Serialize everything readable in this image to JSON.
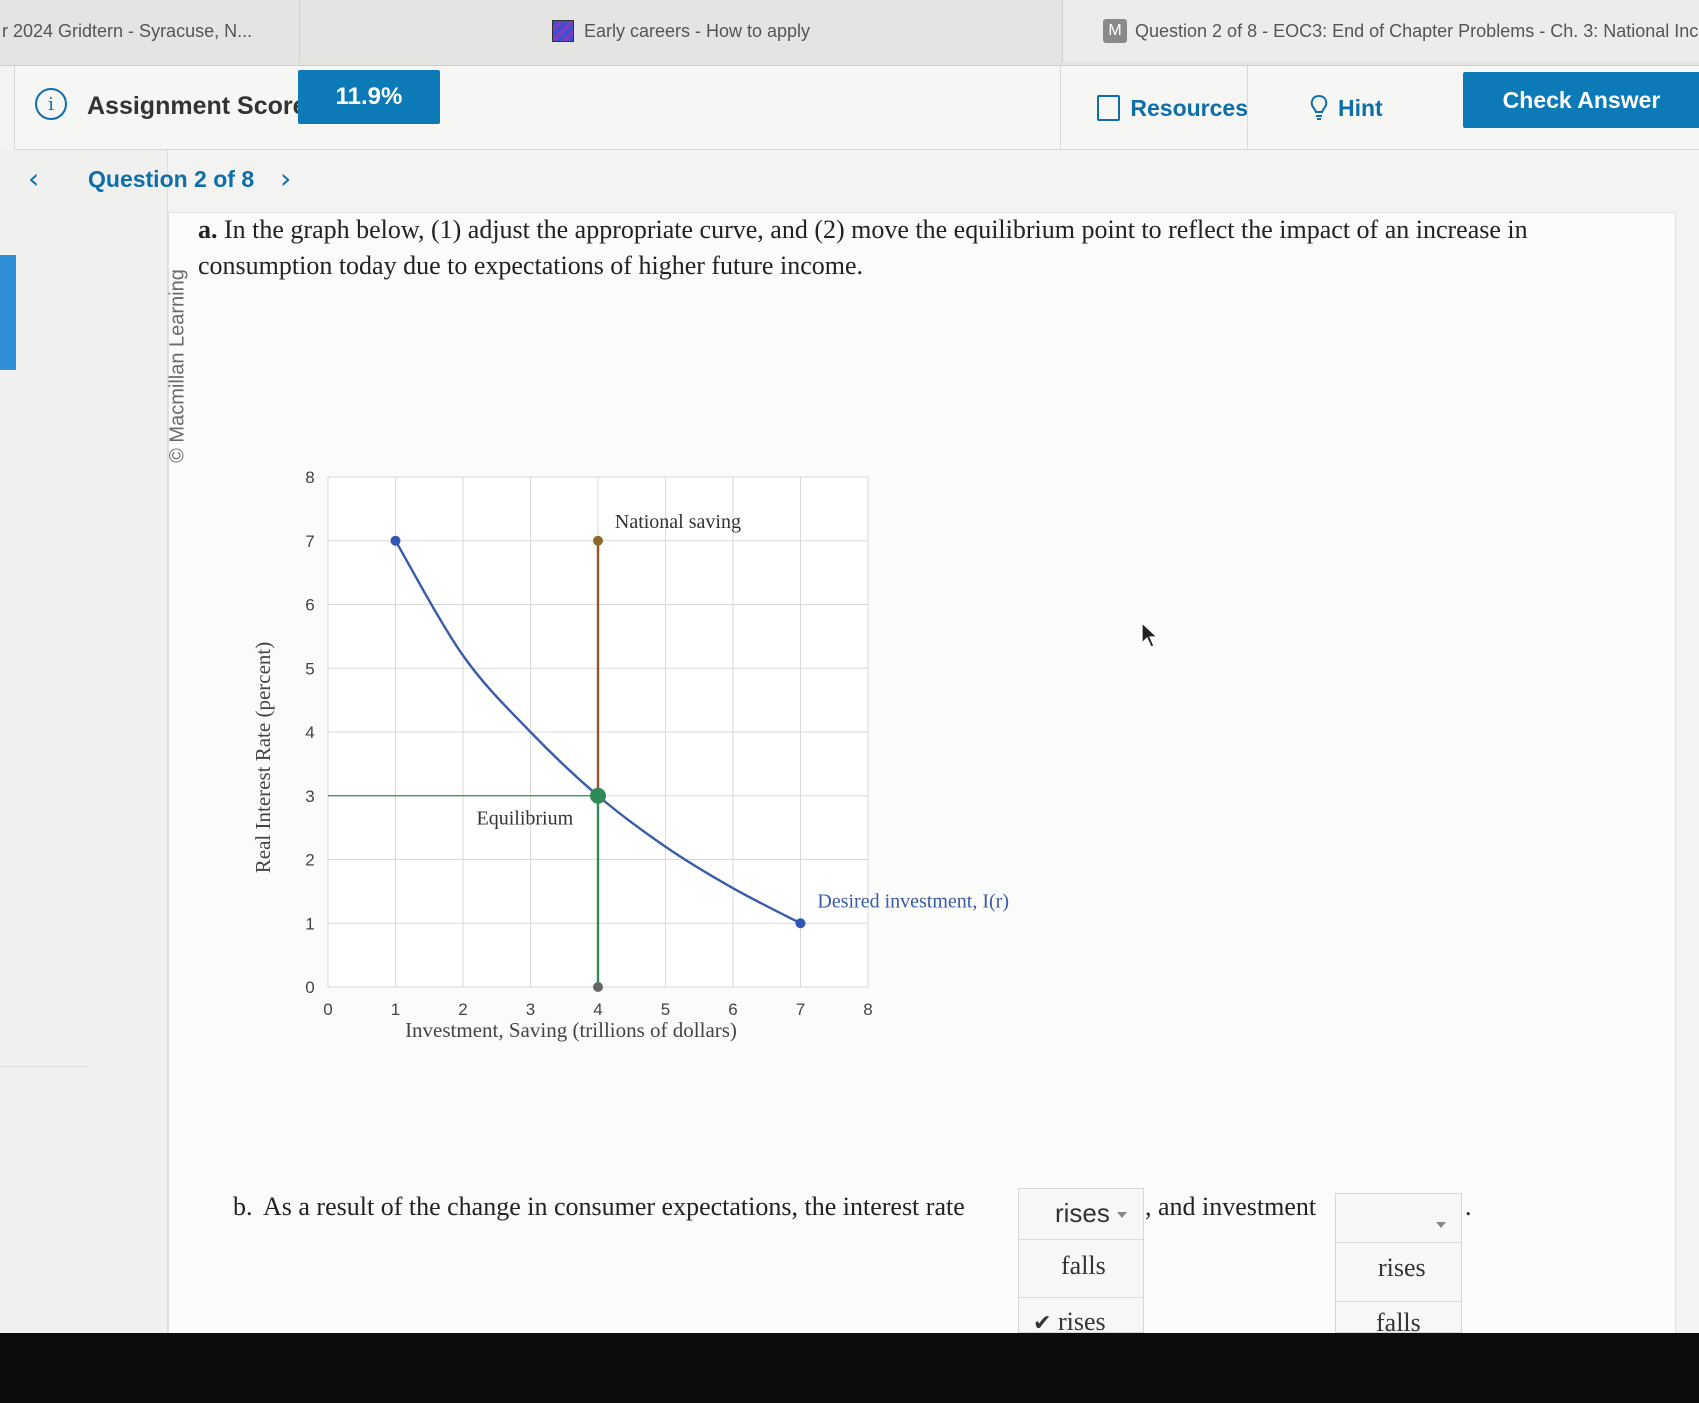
{
  "tabs": [
    {
      "label": "r 2024 Gridtern - Syracuse, N..."
    },
    {
      "label": "Early careers - How to apply"
    },
    {
      "label": "Question 2 of 8 - EOC3: End of Chapter Problems - Ch. 3: National Inc",
      "badge": "M"
    }
  ],
  "header": {
    "score_label": "Assignment Score:",
    "score_value": "11.9%",
    "resources_label": "Resources",
    "hint_label": "Hint",
    "check_answer_label": "Check Answer",
    "accent_color": "#0d7ab8"
  },
  "nav": {
    "question_label": "Question 2 of 8"
  },
  "watermark": "© Macmillan Learning",
  "question": {
    "part_a_prefix": "a.",
    "part_a_text": "In the graph below, (1) adjust the appropriate curve, and (2) move the equilibrium point to reflect the impact of an increase in consumption today due to expectations of higher future income.",
    "part_b_prefix": "b.",
    "part_b_text": "As a result of the change in consumer expectations, the interest rate",
    "part_b_mid": ", and investment",
    "part_b_end": "."
  },
  "dropdown_interest_rate": {
    "selected": "rises",
    "options": [
      "falls",
      "rises"
    ],
    "checked_option": "rises"
  },
  "dropdown_investment": {
    "selected": "",
    "options": [
      "rises",
      "falls"
    ]
  },
  "chart_data": {
    "type": "line",
    "ylabel": "Real Interest Rate (percent)",
    "xlabel": "Investment, Saving (trillions of dollars)",
    "xlim": [
      0,
      8
    ],
    "ylim": [
      0,
      8
    ],
    "x_ticks": [
      "0",
      "1",
      "2",
      "3",
      "4",
      "5",
      "6",
      "7",
      "8"
    ],
    "y_ticks": [
      "0",
      "1",
      "2",
      "3",
      "4",
      "5",
      "6",
      "7",
      "8"
    ],
    "grid": true,
    "series": [
      {
        "name": "Desired investment, I(r)",
        "color": "#3a5ba8",
        "points": [
          [
            1,
            7
          ],
          [
            2,
            5.2
          ],
          [
            3,
            4.0
          ],
          [
            4,
            3
          ],
          [
            5,
            2.2
          ],
          [
            6,
            1.55
          ],
          [
            7,
            1
          ]
        ]
      },
      {
        "name": "National saving",
        "color": "#a0522d",
        "points": [
          [
            4,
            0
          ],
          [
            4,
            7
          ]
        ]
      }
    ],
    "equilibrium": {
      "label": "Equilibrium",
      "x": 4,
      "y": 3,
      "color": "#2e8b57"
    }
  }
}
